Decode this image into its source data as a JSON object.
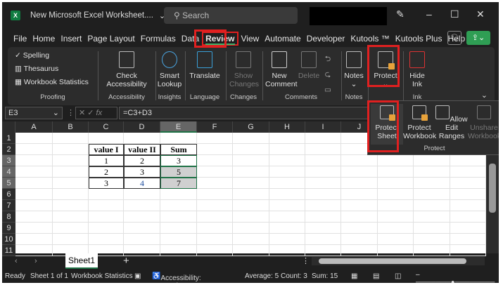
{
  "title": "New Microsoft Excel Worksheet....",
  "search_placeholder": "Search",
  "menu": [
    "File",
    "Home",
    "Insert",
    "Page Layout",
    "Formulas",
    "Data",
    "Review",
    "View",
    "Automate",
    "Developer",
    "Kutools ™",
    "Kutools Plus",
    "Help"
  ],
  "ribbon": {
    "proofing": {
      "items": [
        "Spelling",
        "Thesaurus",
        "Workbook Statistics"
      ],
      "label": "Proofing"
    },
    "accessibility": {
      "button": "Check Accessibility",
      "label": "Accessibility"
    },
    "insights": {
      "button": "Smart Lookup",
      "label": "Insights"
    },
    "language": {
      "button": "Translate",
      "label": "Language"
    },
    "changes": {
      "button": "Show Changes",
      "label": "Changes"
    },
    "comments": {
      "new": "New Comment",
      "delete": "Delete",
      "label": "Comments"
    },
    "notes": {
      "button": "Notes",
      "label": "Notes"
    },
    "protect": {
      "button": "Protect"
    },
    "ink": {
      "button": "Hide Ink",
      "label": "Ink"
    }
  },
  "protect_menu": {
    "items": [
      "Protect Sheet",
      "Protect Workbook",
      "Allow Edit Ranges",
      "Unshare Workbook"
    ],
    "label": "Protect"
  },
  "name_box": "E3",
  "formula": "=C3+D3",
  "columns": [
    "A",
    "B",
    "C",
    "D",
    "E",
    "F",
    "G",
    "H",
    "I",
    "J"
  ],
  "rows": [
    "1",
    "2",
    "3",
    "4",
    "5",
    "6",
    "7",
    "8",
    "9",
    "10",
    "11"
  ],
  "table": {
    "headers": [
      "value I",
      "value II",
      "Sum"
    ],
    "rows": [
      [
        "1",
        "2",
        "3"
      ],
      [
        "2",
        "3",
        "5"
      ],
      [
        "3",
        "4",
        "7"
      ]
    ]
  },
  "sheet_tab": "Sheet1",
  "status": {
    "ready": "Ready",
    "sheet": "Sheet 1 of 1",
    "stats": "Workbook Statistics",
    "accessibility": "Accessibility: Good to go",
    "average": "Average: 5",
    "count": "Count: 3",
    "sum": "Sum: 15"
  }
}
